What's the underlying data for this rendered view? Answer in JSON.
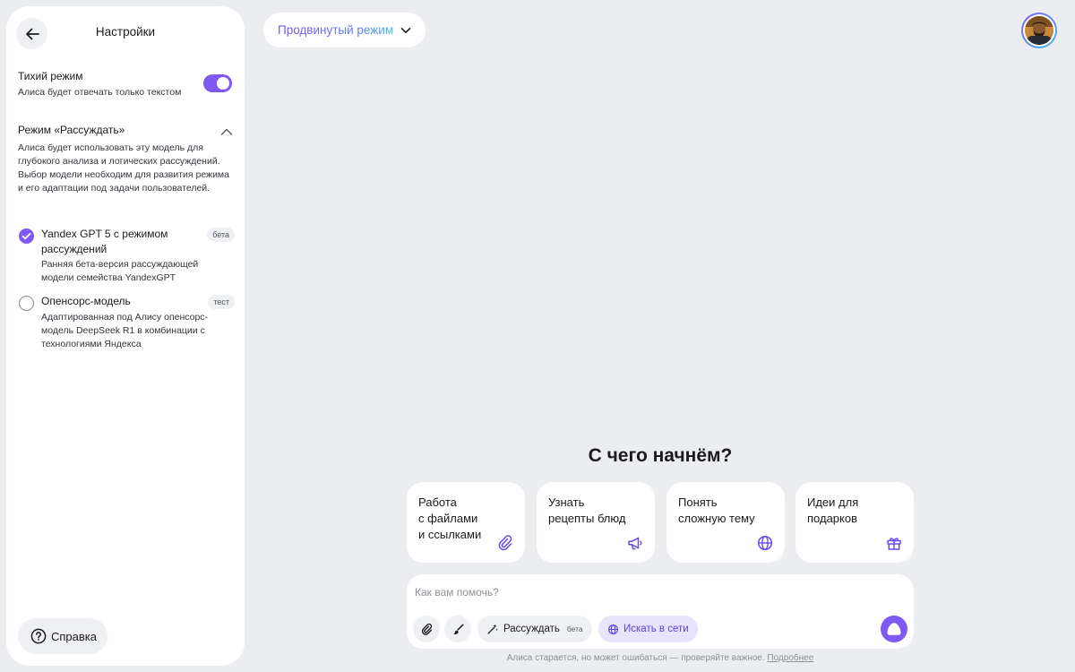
{
  "sidebar": {
    "title": "Настройки",
    "quiet_mode": {
      "title": "Тихий режим",
      "subtitle": "Алиса будет отвечать только текстом",
      "enabled": true
    },
    "reasoning": {
      "title": "Режим «Рассуждать»",
      "description": "Алиса будет использовать эту модель для глубокого анализа и логических рассуждений. Выбор модели необходим для развития режима и его адаптации под задачи пользователей.",
      "models": [
        {
          "name": "Yandex GPT 5 с режимом рассуждений",
          "tag": "бета",
          "description": "Ранняя бета-версия рассуждающей модели семейства YandexGPT",
          "selected": true
        },
        {
          "name": "Опенсорс-модель",
          "tag": "тест",
          "description": "Адаптированная под Алису опенсорс-модель DeepSeek R1 в комбинации с технологиями Яндекса",
          "selected": false
        }
      ]
    },
    "help_label": "Справка"
  },
  "header": {
    "mode_label": "Продвинутый режим"
  },
  "main": {
    "headline": "С чего начнём?",
    "cards": [
      {
        "label": "Работа\nс файлами\nи ссылками",
        "icon": "paperclip-icon"
      },
      {
        "label": "Узнать\nрецепты блюд",
        "icon": "megaphone-icon"
      },
      {
        "label": "Понять\nсложную тему",
        "icon": "globe-icon"
      },
      {
        "label": "Идеи для\nподарков",
        "icon": "gift-icon"
      }
    ],
    "composer": {
      "placeholder": "Как вам помочь?",
      "reason_label": "Рассуждать",
      "reason_tag": "бета",
      "search_label": "Искать в сети"
    },
    "disclaimer": "Алиса старается, но может ошибаться — проверяйте важное.",
    "disclaimer_link": "Подробнее"
  },
  "colors": {
    "accent": "#7e59f2",
    "background": "#ecedf1",
    "panel": "#ffffff"
  }
}
